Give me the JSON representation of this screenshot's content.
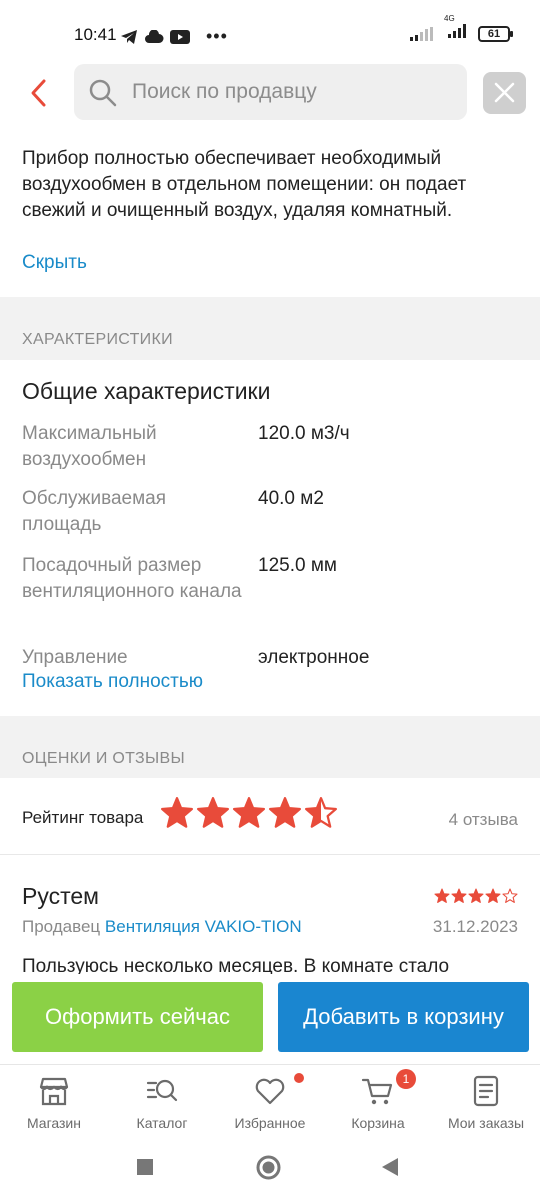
{
  "status_bar": {
    "time": "10:41",
    "battery": "61",
    "network": "4G"
  },
  "search": {
    "placeholder": "Поиск по продавцу"
  },
  "description": {
    "text": "Прибор полностью обеспечивает необходимый воздухообмен в отдельном помещении: он подает свежий и очищенный воздух, удаляя комнатный.",
    "hide_label": "Скрыть"
  },
  "characteristics": {
    "section_label": "ХАРАКТЕРИСТИКИ",
    "group_title": "Общие характеристики",
    "rows": [
      {
        "key": "Максимальный воздухообмен",
        "value": "120.0 м3/ч"
      },
      {
        "key": "Обслуживаемая площадь",
        "value": "40.0 м2"
      },
      {
        "key": "Посадочный размер вентиляционного канала",
        "value": "125.0 мм"
      },
      {
        "key": "Управление",
        "value": "электронное"
      }
    ],
    "show_full_label": "Показать полностью"
  },
  "reviews": {
    "section_label": "ОЦЕНКИ И ОТЗЫВЫ",
    "rating_label": "Рейтинг товара",
    "rating_value": 4.5,
    "count_label": "4 отзыва",
    "items": [
      {
        "author": "Рустем",
        "stars": 4,
        "seller_prefix": "Продавец",
        "seller_name": "Вентиляция VAKIO-TION",
        "date": "31.12.2023",
        "text": "Пользуюсь несколько месяцев. В комнате стало"
      }
    ]
  },
  "actions": {
    "order_label": "Оформить сейчас",
    "cart_label": "Добавить в корзину"
  },
  "nav": {
    "items": [
      {
        "label": "Магазин",
        "icon": "shop-icon"
      },
      {
        "label": "Каталог",
        "icon": "catalog-search-icon"
      },
      {
        "label": "Избранное",
        "icon": "heart-icon"
      },
      {
        "label": "Корзина",
        "icon": "cart-icon",
        "badge": "1"
      },
      {
        "label": "Мои заказы",
        "icon": "orders-icon"
      }
    ]
  },
  "colors": {
    "accent_red": "#e84b3a",
    "link_blue": "#1a8bc9",
    "order_green": "#8bd146",
    "cart_blue": "#1a86d0"
  }
}
